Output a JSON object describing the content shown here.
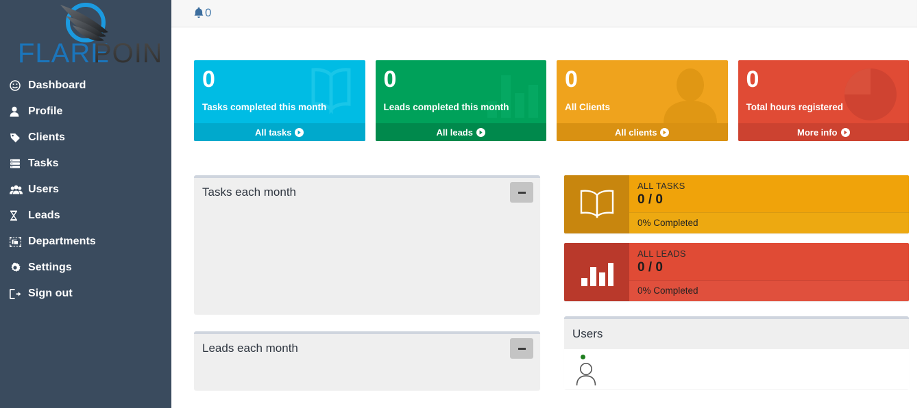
{
  "brand": {
    "name_part1": "FLARE",
    "name_part2": "POINT",
    "color_part1": "#1b75bb",
    "color_part2": "#3f3f3f",
    "logo_icon": "flarepoint-globe-swoosh-logo"
  },
  "sidebar": {
    "items": [
      {
        "label": "Dashboard",
        "icon": "dashboard-icon"
      },
      {
        "label": "Profile",
        "icon": "user-icon"
      },
      {
        "label": "Clients",
        "icon": "tag-icon"
      },
      {
        "label": "Tasks",
        "icon": "server-list-icon"
      },
      {
        "label": "Users",
        "icon": "users-group-icon"
      },
      {
        "label": "Leads",
        "icon": "hourglass-icon"
      },
      {
        "label": "Departments",
        "icon": "object-group-icon"
      },
      {
        "label": "Settings",
        "icon": "gear-icon"
      },
      {
        "label": "Sign out",
        "icon": "sign-out-icon"
      }
    ],
    "background_color": "#3a4b5e"
  },
  "topbar": {
    "notifications_icon": "bell-icon",
    "notifications_count": "0",
    "accent_color": "#4679a7"
  },
  "cards": [
    {
      "value": "0",
      "label": "Tasks completed this month",
      "footer": "All tasks",
      "icon": "book-icon",
      "color": "#00bce4",
      "footer_color": "#00a9cc"
    },
    {
      "value": "0",
      "label": "Leads completed this month",
      "footer": "All leads",
      "icon": "bar-chart-icon",
      "color": "#00a15a",
      "footer_color": "#00894c"
    },
    {
      "value": "0",
      "label": "All Clients",
      "footer": "All clients",
      "icon": "user-silhouette-icon",
      "color": "#efa31d",
      "footer_color": "#d99112"
    },
    {
      "value": "0",
      "label": "Total hours registered",
      "footer": "More info",
      "icon": "pie-chart-icon",
      "color": "#e04b35",
      "footer_color": "#cc4230"
    }
  ],
  "panels": {
    "tasks_chart": {
      "title": "Tasks each month",
      "collapse_label": "−"
    },
    "leads_chart": {
      "title": "Leads each month",
      "collapse_label": "−"
    },
    "users": {
      "title": "Users",
      "online_user_status_color": "#1e7e1e",
      "avatar_icon": "user-outline-icon"
    }
  },
  "progress_widgets": [
    {
      "label": "ALL TASKS",
      "value": "0 / 0",
      "completed": "0% Completed",
      "icon": "book-icon",
      "color": "#f0a30a",
      "icon_color": "#c8860e"
    },
    {
      "label": "ALL LEADS",
      "value": "0 / 0",
      "completed": "0% Completed",
      "icon": "bar-chart-icon",
      "color": "#e04b35",
      "icon_color": "#b9392b"
    }
  ]
}
